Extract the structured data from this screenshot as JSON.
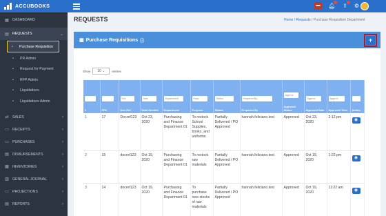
{
  "app": {
    "brand": "ACCUBOOKS"
  },
  "sidebar": {
    "items": [
      {
        "label": "DASHBOARD",
        "icon": "dashboard-icon"
      },
      {
        "label": "REQUESTS",
        "icon": "requests-icon"
      },
      {
        "label": "SALES",
        "icon": "sales-icon"
      },
      {
        "label": "RECEIPTS",
        "icon": "receipts-icon"
      },
      {
        "label": "PURCHASES",
        "icon": "purchases-icon"
      },
      {
        "label": "DISBURSEMENTS",
        "icon": "disbursements-icon"
      },
      {
        "label": "INVENTORIES",
        "icon": "inventories-icon"
      },
      {
        "label": "GENERAL JOURNAL",
        "icon": "journal-icon"
      },
      {
        "label": "PROJECTIONS",
        "icon": "projections-icon"
      },
      {
        "label": "REPORTS",
        "icon": "reports-icon"
      }
    ],
    "sub_items": [
      {
        "label": "Purchase Requisition"
      },
      {
        "label": "PR Admin"
      },
      {
        "label": "Request for Payment"
      },
      {
        "label": "RFP Admin"
      },
      {
        "label": "Liquidations"
      },
      {
        "label": "Liquidations Admin"
      }
    ]
  },
  "page": {
    "title": "REQUESTS",
    "breadcrumb": {
      "home": "Home",
      "sep1": "/",
      "requests": "Requests",
      "sep2": "/",
      "current": "Purchase Requisition Department"
    }
  },
  "card": {
    "title": "Purchase Requisitions",
    "add_label": "+"
  },
  "length_menu": {
    "show": "Show",
    "value": "10",
    "entries": "entries"
  },
  "table": {
    "filters": [
      "",
      "",
      "Doc",
      "Date",
      "Department",
      "Purp",
      "Status",
      "Prepared By",
      "Approv",
      "Approv",
      "Approv",
      ""
    ],
    "headers": [
      "#",
      "PR#",
      "Doc Ref",
      "Date Needed",
      "Department",
      "Purpose",
      "Status",
      "Prepared By",
      "Approval Status",
      "Approval Date",
      "Approval Time",
      "Action"
    ],
    "rows": [
      {
        "idx": "1",
        "pr": "17",
        "doc": "Docref123",
        "date": "Oct 23, 2020",
        "dept": "Purchasing and Finance Department 01",
        "purpose": "To restock School Supplies, books, and uniforms.",
        "status": "Partially Delivered / PO Approved",
        "prepared": "hannah.feliciano.test",
        "ap_status": "Approved",
        "ap_date": "Oct 23, 2020",
        "ap_time": "2:12 pm"
      },
      {
        "idx": "2",
        "pr": "15",
        "doc": "docref123",
        "date": "Oct 19, 2020",
        "dept": "Purchasing and Finance Department 01",
        "purpose": "To restock raw materials",
        "status": "Partially Delivered / PO Approved",
        "prepared": "hannah.feliciano.test",
        "ap_status": "Approved",
        "ap_date": "Oct 19, 2020",
        "ap_time": "1:22 pm"
      },
      {
        "idx": "3",
        "pr": "14",
        "doc": "docref123",
        "date": "Oct 19, 2020",
        "dept": "Purchasing and Finance Department 01",
        "purpose": "To purchase new stocks of raw materials",
        "status": "Partially Delivered / PO Approved",
        "prepared": "hannah.feliciano.test",
        "ap_status": "Approved",
        "ap_date": "Oct 19, 2020",
        "ap_time": "11:22 am"
      }
    ]
  },
  "colors": {
    "primary": "#2a6fc9",
    "sidebar": "#2c3440",
    "card_header": "#4a8fdc",
    "table_header": "#7fb0f0",
    "highlight": "#f3c623",
    "add_border": "#b0182b"
  }
}
